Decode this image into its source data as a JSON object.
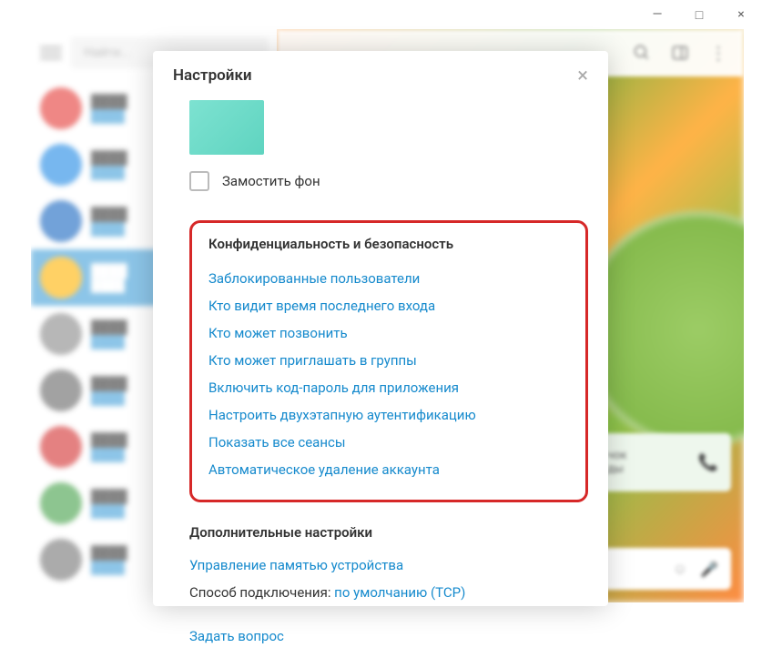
{
  "window": {
    "minimize": "—",
    "maximize": "□",
    "close": "×"
  },
  "search": {
    "placeholder": "Найти..."
  },
  "modal": {
    "title": "Настройки",
    "tile_bg_label": "Замостить фон",
    "privacy_title": "Конфиденциальность и безопасность",
    "privacy_links": [
      "Заблокированные пользователи",
      "Кто видит время последнего входа",
      "Кто может позвонить",
      "Кто может приглашать в группы",
      "Включить код-пароль для приложения",
      "Настроить двухэтапную аутентификацию",
      "Показать все сеансы",
      "Автоматическое удаление аккаунта"
    ],
    "advanced_title": "Дополнительные настройки",
    "storage_link": "Управление памятью устройства",
    "connection_label": "Способ подключения: ",
    "connection_value": "по умолчанию (TCP)",
    "ask_link": "Задать вопрос"
  },
  "call": {
    "label": "чок",
    "sub": "ды"
  },
  "chats": [
    {
      "color": "#e53935"
    },
    {
      "color": "#1e88e5"
    },
    {
      "color": "#1565c0"
    },
    {
      "color": "#ffb300",
      "active": true
    },
    {
      "color": "#888"
    },
    {
      "color": "#666"
    },
    {
      "color": "#d32f2f"
    },
    {
      "color": "#43a047"
    },
    {
      "color": "#757575"
    }
  ]
}
